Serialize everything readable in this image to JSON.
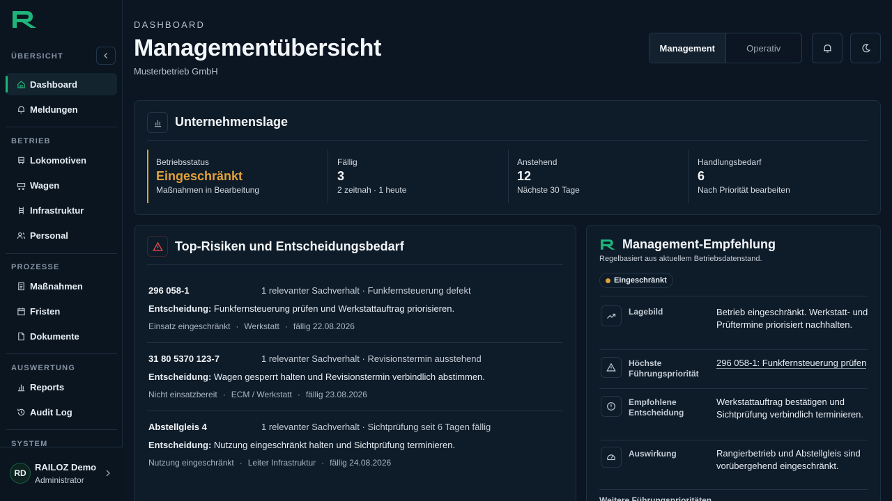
{
  "sidebar": {
    "sections": {
      "overview": "ÜBERSICHT",
      "betrieb": "BETRIEB",
      "prozesse": "PROZESSE",
      "auswertung": "AUSWERTUNG",
      "system": "SYSTEM"
    },
    "items": {
      "dashboard": "Dashboard",
      "meldungen": "Meldungen",
      "lokomotiven": "Lokomotiven",
      "wagen": "Wagen",
      "infrastruktur": "Infrastruktur",
      "personal": "Personal",
      "massnahmen": "Maßnahmen",
      "fristen": "Fristen",
      "dokumente": "Dokumente",
      "reports": "Reports",
      "audit": "Audit Log"
    },
    "active_item": "Dashboard",
    "user": {
      "initials": "RD",
      "name": "RAILOZ Demo",
      "role": "Administrator"
    }
  },
  "header": {
    "eyebrow": "DASHBOARD",
    "title": "Managementübersicht",
    "subtitle": "Musterbetrieb GmbH",
    "modes": [
      "Management",
      "Operativ"
    ],
    "active_mode": "Management"
  },
  "lage": {
    "title": "Unternehmenslage",
    "kpis": [
      {
        "label": "Betriebsstatus",
        "value": "Eingeschränkt",
        "note": "Maßnahmen in Bearbeitung"
      },
      {
        "label": "Fällig",
        "value": "3",
        "note": "2 zeitnah · 1 heute"
      },
      {
        "label": "Anstehend",
        "value": "12",
        "note": "Nächste 30 Tage"
      },
      {
        "label": "Handlungsbedarf",
        "value": "6",
        "note": "Nach Priorität bearbeiten"
      }
    ]
  },
  "risks": {
    "title": "Top-Risiken und Entscheidungsbedarf",
    "decision_label": "Entscheidung:",
    "items": [
      {
        "id": "296 058-1",
        "desc": "1 relevanter Sachverhalt · Funkfernsteuerung defekt",
        "decision": "Funkfernsteuerung prüfen und Werkstattauftrag priorisieren.",
        "meta": [
          "Einsatz eingeschränkt",
          "Werkstatt",
          "fällig 22.08.2026"
        ]
      },
      {
        "id": "31 80 5370 123-7",
        "desc": "1 relevanter Sachverhalt · Revisionstermin ausstehend",
        "decision": "Wagen gesperrt halten und Revisionstermin verbindlich abstimmen.",
        "meta": [
          "Nicht einsatzbereit",
          "ECM / Werkstatt",
          "fällig 23.08.2026"
        ]
      },
      {
        "id": "Abstellgleis 4",
        "desc": "1 relevanter Sachverhalt · Sichtprüfung seit 6 Tagen fällig",
        "decision": "Nutzung eingeschränkt halten und Sichtprüfung terminieren.",
        "meta": [
          "Nutzung eingeschränkt",
          "Leiter Infrastruktur",
          "fällig 24.08.2026"
        ]
      }
    ]
  },
  "recommendation": {
    "title": "Management-Empfehlung",
    "subtitle": "Regelbasiert aus aktuellem Betriebsdatenstand.",
    "badge": "Eingeschränkt",
    "rows": [
      {
        "icon": "trend-up-icon",
        "label": "Lagebild",
        "text": "Betrieb eingeschränkt. Werkstatt- und Prüftermine priorisiert nachhalten."
      },
      {
        "icon": "warning-icon",
        "label": "Höchste Führungspriorität",
        "text": "296 058-1: Funkfernsteuerung prüfen"
      },
      {
        "icon": "alert-circle-icon",
        "label": "Empfohlene Entscheidung",
        "text": "Werkstattauftrag bestätigen und Sichtprüfung verbindlich terminieren."
      },
      {
        "icon": "gauge-icon",
        "label": "Auswirkung",
        "text": "Rangierbetrieb und Abstellgleis sind vorübergehend eingeschränkt."
      }
    ],
    "more": "Weitere Führungsprioritäten"
  },
  "colors": {
    "accent": "#1fb57a",
    "warning": "#e0a23a",
    "danger": "#e5484d",
    "background": "#0b1622"
  }
}
